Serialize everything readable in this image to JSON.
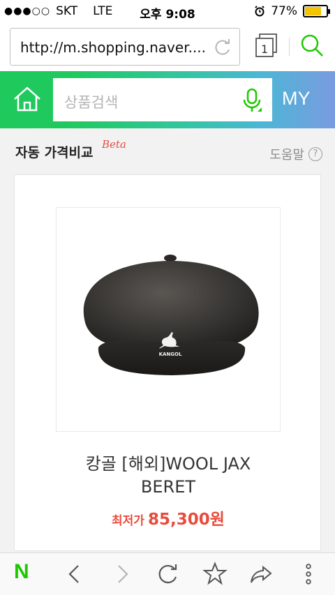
{
  "status_bar": {
    "signal": "●●●○○",
    "carrier": "SKT",
    "network": "LTE",
    "time": "오후 9:08",
    "battery_percent": "77%",
    "battery_level": 0.77
  },
  "browser": {
    "url": "http://m.shopping.naver....",
    "tab_count": "1"
  },
  "naver_header": {
    "search_placeholder": "상품검색",
    "my_label": "MY"
  },
  "section": {
    "title": "자동 가격비교",
    "beta_label": "Beta",
    "help_label": "도움말",
    "help_icon": "?"
  },
  "product": {
    "name_line1": "캉골 [해외]WOOL JAX",
    "name_line2": "BERET",
    "price_label": "최저가",
    "price_value": "85,300원",
    "logo_text": "KANGOL"
  },
  "toolbar": {
    "naver_label": "N"
  },
  "colors": {
    "naver_green": "#1ec800",
    "price_red": "#e84c3d",
    "battery_yellow": "#f5c400"
  }
}
